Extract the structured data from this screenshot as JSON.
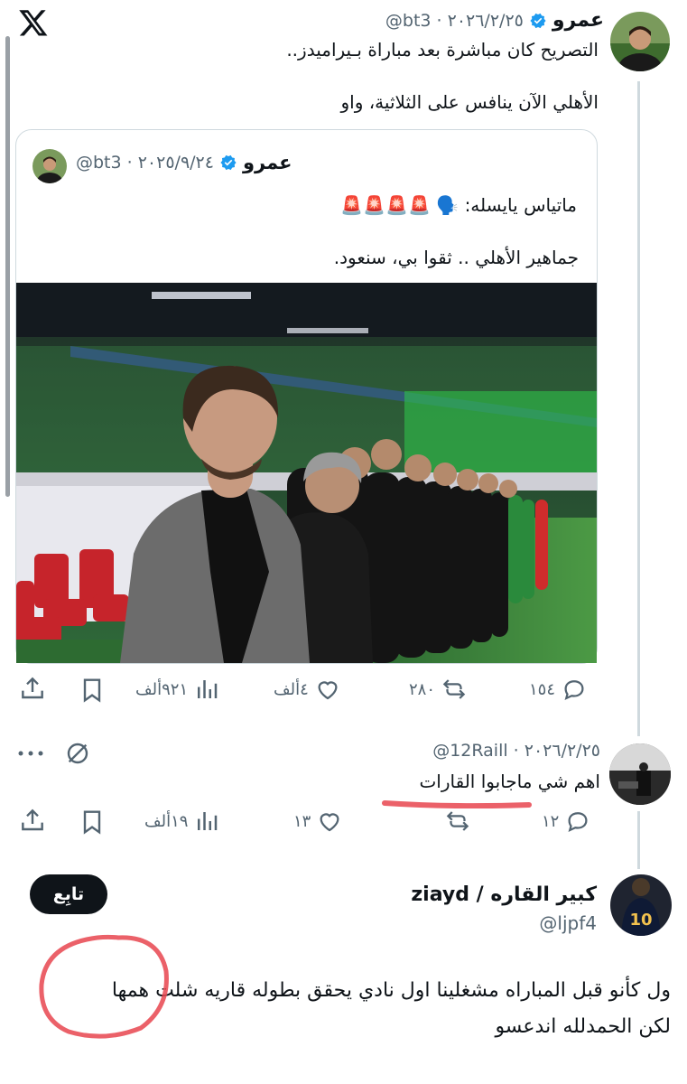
{
  "main_tweet": {
    "author_name": "عمرو",
    "handle_date": "@bt3 · ٢٠٢٦/٢/٢٥",
    "text_line1": "التصريح كان مباشرة بعد مباراة بـيراميدز..",
    "text_line2": "الأهلي الآن ينافس على الثلاثية، واو"
  },
  "quoted_tweet": {
    "author_name": "عمرو",
    "handle_date": "@bt3 · ٢٠٢٥/٩/٢٤",
    "text_line1": "ماتياس يايسله: 🗣️ 🚨🚨🚨🚨",
    "text_line2": "جماهير الأهلي .. ثقوا بي، سنعود."
  },
  "main_actions": {
    "replies": "١٥٤",
    "retweets": "٢٨٠",
    "likes": "٤ألف",
    "views": "٩٢١ألف"
  },
  "reply_tweet": {
    "handle_date": "@12Raill · ٢٠٢٦/٢/٢٥",
    "text": "اهم شي ماجابوا القارات",
    "replies": "١٢",
    "likes": "١٣",
    "views": "١٩ألف"
  },
  "third_tweet": {
    "author_name": "كبير القاره / ziayd",
    "handle": "@ljpf4",
    "follow_label": "تابِع",
    "text_line1": "ول كأنو قبل المباراه مشغلينا اول نادي يحقق بطوله قاريه شلت همها",
    "text_line2": "لكن الحمدلله اندعسو"
  },
  "colors": {
    "verified_blue": "#1d9bf0",
    "muted_gray": "#536471",
    "annotation_red": "#e8454f"
  },
  "icons": [
    "x-logo-icon",
    "verified-icon",
    "reply-icon",
    "retweet-icon",
    "like-icon",
    "views-icon",
    "bookmark-icon",
    "share-icon",
    "more-icon",
    "grok-icon"
  ]
}
